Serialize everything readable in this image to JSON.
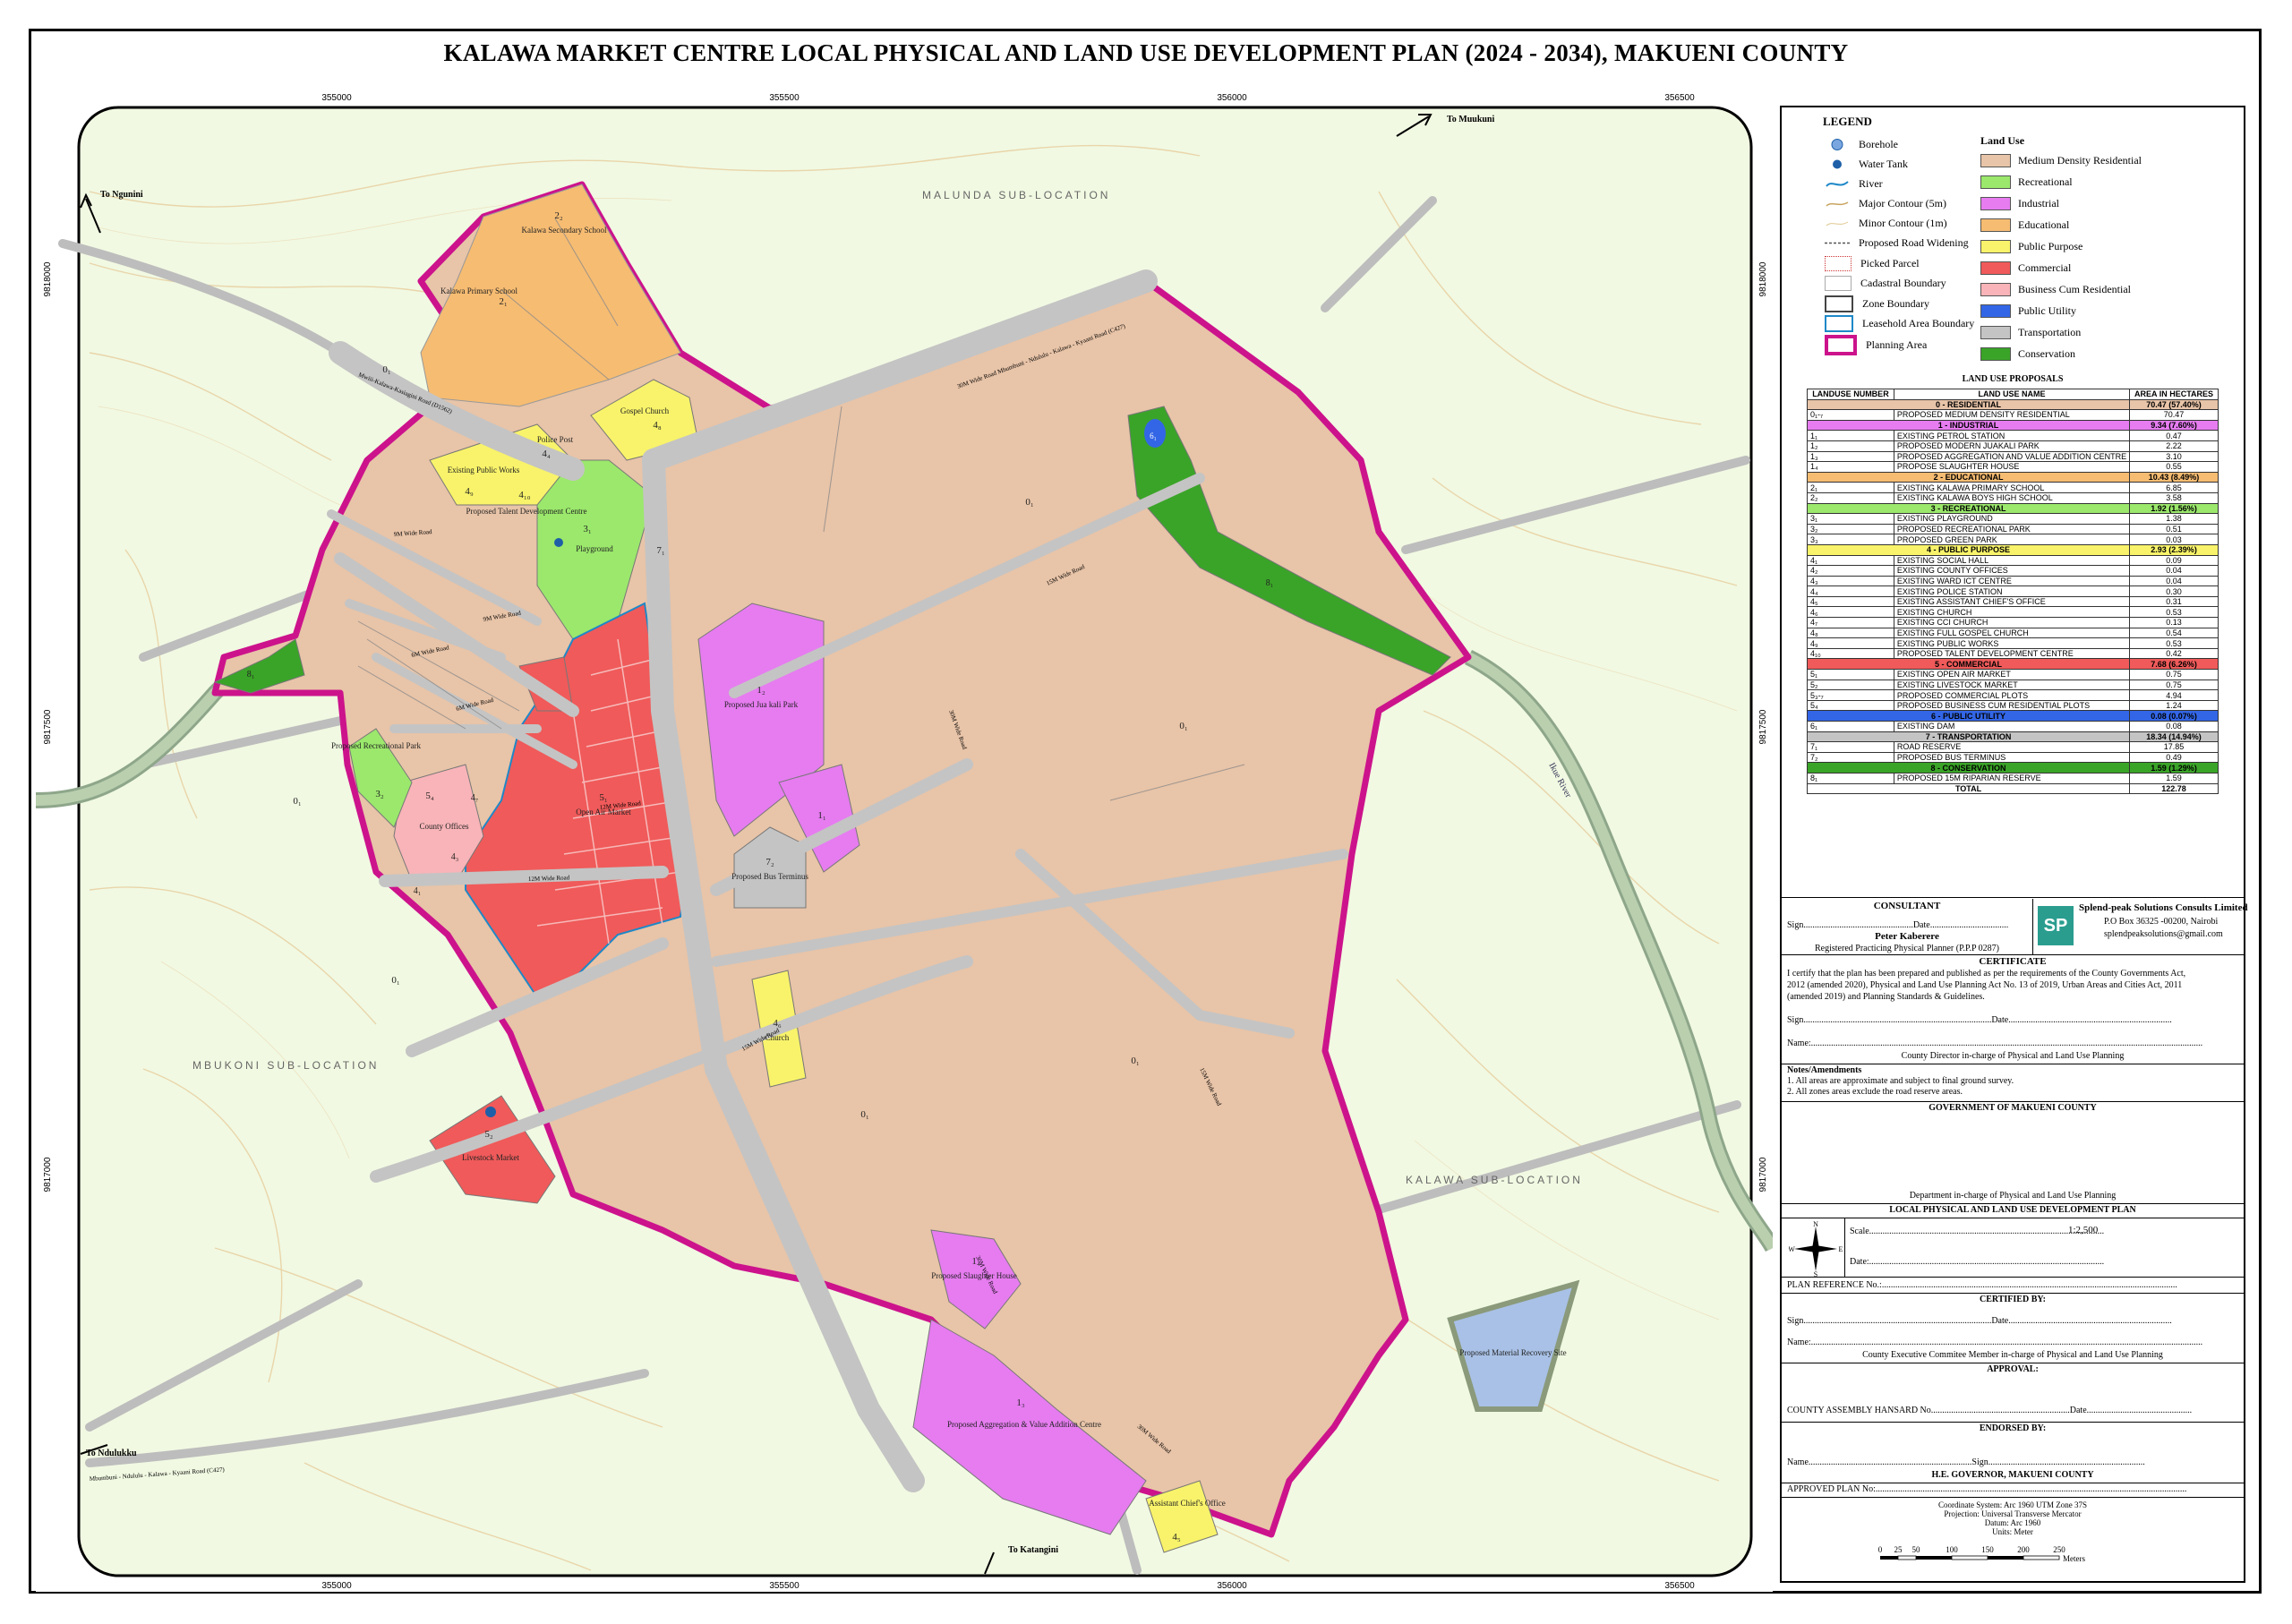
{
  "title": "KALAWA MARKET CENTRE LOCAL PHYSICAL AND LAND USE DEVELOPMENT PLAN (2024 - 2034), MAKUENI COUNTY",
  "grid": {
    "easting": [
      "355000",
      "355500",
      "356000",
      "356500"
    ],
    "northing": [
      "9818000",
      "9817500",
      "9817000"
    ]
  },
  "map": {
    "directions": {
      "to_ngunini": "To Ngunini",
      "to_muukuni": "To Muukuni",
      "to_ndulukku": "To Ndulukku",
      "to_katangini": "To Katangini"
    },
    "sublocations": {
      "malunda": "MALUNDA SUB-LOCATION",
      "mbukoni": "MBUKONI SUB-LOCATION",
      "kalawa": "KALAWA SUB-LOCATION"
    },
    "roads": {
      "mwiii": "Mwiii-Kalawa-Kasiagini Road (D1562)",
      "mbumbuni_top": "30M Wide Road  Mbumbuni - Ndululu - Kalawa - Kyaani Road (C427)",
      "mbumbuni_bottom": "Mbumbuni - Ndululu - Kalawa - Kyaani Road (C427)",
      "r30": "30M Wide Road",
      "r15": "15M Wide Road",
      "r12": "12M Wide Road",
      "r9": "9M Wide Road",
      "r6": "6M Wide Road"
    },
    "river": "Ikue River",
    "labels": {
      "primary": "Kalawa Primary School",
      "primary_code": "2₁",
      "secondary": "Kalawa Secondary School",
      "secondary_code": "2₂",
      "gospel": "Gospel Church",
      "gospel_code": "4₈",
      "police": "Police Post",
      "police_code": "4₄",
      "public_works": "Existing Public Works",
      "public_works_code": "4₉",
      "talent": "Proposed Talent Development Centre",
      "talent_code": "4₁₀",
      "playground": "Playground",
      "playground_code": "3₁",
      "jua_kali": "Proposed Jua kali Park",
      "jua_kali_code": "1₂",
      "open_air": "Open Air Market",
      "open_air_code": "5₁",
      "bus": "Proposed Bus Terminus",
      "bus_code": "7₂",
      "church": "Church",
      "church_code": "4₆",
      "petrol_code": "1₁",
      "rec_park": "Proposed Recreational Park",
      "rec_park_code": "3₂",
      "bcr_code": "5₄",
      "county": "County Offices",
      "livestock": "Livestock Market",
      "livestock_code": "5₂",
      "slaughter": "Proposed Slaughter House",
      "slaughter_code": "1₄",
      "agg": "Proposed Aggregation & Value Addition Centre",
      "agg_code": "1₃",
      "chief": "Assistant Chief's Office",
      "chief_code": "4₅",
      "mrs": "Proposed Material Recovery Site",
      "res_code": "0₁",
      "cons_code": "8₁",
      "dam_code": "6₁",
      "road_code": "7₁",
      "ward_code": "4₃",
      "hall_code": "4₁",
      "ccm_code": "4₇"
    }
  },
  "legend": {
    "title": "LEGEND",
    "symbols": [
      "Borehole",
      "Water Tank",
      "River",
      "Major Contour (5m)",
      "Minor Contour (1m)",
      "Proposed Road Widening",
      "Picked Parcel",
      "Cadastral Boundary",
      "Zone Boundary",
      "Leasehold Area Boundary",
      "Planning Area"
    ],
    "land_use_title": "Land Use",
    "land_uses": [
      {
        "label": "Medium Density Residential",
        "color": "#e8c4a8"
      },
      {
        "label": "Recreational",
        "color": "#9be86c"
      },
      {
        "label": "Industrial",
        "color": "#e67cf0"
      },
      {
        "label": "Educational",
        "color": "#f6bc72"
      },
      {
        "label": "Public Purpose",
        "color": "#f8f36a"
      },
      {
        "label": "Commercial",
        "color": "#f05a5a"
      },
      {
        "label": "Business Cum Residential",
        "color": "#f8b4b8"
      },
      {
        "label": "Public Utility",
        "color": "#3366e6"
      },
      {
        "label": "Transportation",
        "color": "#c4c4c4"
      },
      {
        "label": "Conservation",
        "color": "#3aa428"
      }
    ]
  },
  "table": {
    "title": "LAND USE PROPOSALS",
    "headers": [
      "LANDUSE NUMBER",
      "LAND USE NAME",
      "AREA IN HECTARES"
    ],
    "rows": [
      {
        "cat": true,
        "name": "0 - RESIDENTIAL",
        "area": "70.47 (57.40%)",
        "color": "#e8c4a8"
      },
      {
        "num": "0₁-₇",
        "name": "PROPOSED MEDIUM DENSITY RESIDENTIAL",
        "area": "70.47"
      },
      {
        "cat": true,
        "name": "1 - INDUSTRIAL",
        "area": "9.34 (7.60%)",
        "color": "#e67cf0"
      },
      {
        "num": "1₁",
        "name": "EXISTING PETROL STATION",
        "area": "0.47"
      },
      {
        "num": "1₂",
        "name": "PROPOSED MODERN JUAKALI PARK",
        "area": "2.22"
      },
      {
        "num": "1₃",
        "name": "PROPOSED AGGREGATION AND VALUE ADDITION CENTRE",
        "area": "3.10"
      },
      {
        "num": "1₄",
        "name": "PROPOSE SLAUGHTER HOUSE",
        "area": "0.55"
      },
      {
        "cat": true,
        "name": "2 - EDUCATIONAL",
        "area": "10.43 (8.49%)",
        "color": "#f6bc72"
      },
      {
        "num": "2₁",
        "name": "EXISTING KALAWA PRIMARY SCHOOL",
        "area": "6.85"
      },
      {
        "num": "2₂",
        "name": "EXISTING KALAWA BOYS HIGH SCHOOL",
        "area": "3.58"
      },
      {
        "cat": true,
        "name": "3 - RECREATIONAL",
        "area": "1.92 (1.56%)",
        "color": "#9be86c"
      },
      {
        "num": "3₁",
        "name": "EXISTING PLAYGROUND",
        "area": "1.38"
      },
      {
        "num": "3₂",
        "name": "PROPOSED RECREATIONAL PARK",
        "area": "0.51"
      },
      {
        "num": "3₃",
        "name": "PROPOSED GREEN PARK",
        "area": "0.03"
      },
      {
        "cat": true,
        "name": "4 - PUBLIC PURPOSE",
        "area": "2.93 (2.39%)",
        "color": "#f8f36a"
      },
      {
        "num": "4₁",
        "name": "EXISTING SOCIAL HALL",
        "area": "0.09"
      },
      {
        "num": "4₂",
        "name": "EXISTING COUNTY OFFICES",
        "area": "0.04"
      },
      {
        "num": "4₃",
        "name": "EXISTING WARD ICT CENTRE",
        "area": "0.04"
      },
      {
        "num": "4₄",
        "name": "EXISTING POLICE STATION",
        "area": "0.30"
      },
      {
        "num": "4₅",
        "name": "EXISTING ASSISTANT CHIEF'S OFFICE",
        "area": "0.31"
      },
      {
        "num": "4₆",
        "name": "EXISTING CHURCH",
        "area": "0.53"
      },
      {
        "num": "4₇",
        "name": "EXISTING CCI CHURCH",
        "area": "0.13"
      },
      {
        "num": "4₈",
        "name": "EXISTING FULL GOSPEL CHURCH",
        "area": "0.54"
      },
      {
        "num": "4₉",
        "name": "EXISTING PUBLIC WORKS",
        "area": "0.53"
      },
      {
        "num": "4₁₀",
        "name": "PROPOSED TALENT DEVELOPMENT CENTRE",
        "area": "0.42"
      },
      {
        "cat": true,
        "name": "5 - COMMERCIAL",
        "area": "7.68 (6.26%)",
        "color": "#f05a5a"
      },
      {
        "num": "5₁",
        "name": "EXISTING OPEN AIR MARKET",
        "area": "0.75"
      },
      {
        "num": "5₂",
        "name": "EXISTING LIVESTOCK MARKET",
        "area": "0.75"
      },
      {
        "num": "5₃-₇",
        "name": "PROPOSED COMMERCIAL PLOTS",
        "area": "4.94"
      },
      {
        "num": "5₄",
        "name": "PROPOSED BUSINESS CUM RESIDENTIAL PLOTS",
        "area": "1.24"
      },
      {
        "cat": true,
        "name": "6 - PUBLIC UTILITY",
        "area": "0.08 (0.07%)",
        "color": "#3366e6"
      },
      {
        "num": "6₁",
        "name": "EXISTING DAM",
        "area": "0.08"
      },
      {
        "cat": true,
        "name": "7 - TRANSPORTATION",
        "area": "18.34 (14.94%)",
        "color": "#c4c4c4"
      },
      {
        "num": "7₁",
        "name": "ROAD RESERVE",
        "area": "17.85"
      },
      {
        "num": "7₂",
        "name": "PROPOSED BUS TERMINUS",
        "area": "0.49"
      },
      {
        "cat": true,
        "name": "8 - CONSERVATION",
        "area": "1.59 (1.29%)",
        "color": "#3aa428"
      },
      {
        "num": "8₁",
        "name": "PROPOSED 15M RIPARIAN RESERVE",
        "area": "1.59"
      },
      {
        "total": true,
        "name": "TOTAL",
        "area": "122.78"
      }
    ]
  },
  "consultant": {
    "heading": "CONSULTANT",
    "sign_line": "Sign.................................................Date...................................",
    "name": "Peter Kaberere",
    "role": "Registered Practicing Physical Planner (P.P.P 0287)",
    "logo": "SP",
    "company": "Splend-peak Solutions Consults Limited",
    "address": "P.O Box 36325 -00200, Nairobi",
    "email": "splendpeaksolutions@gmail.com"
  },
  "certificate": {
    "heading": "CERTIFICATE",
    "text1": "I certify that the plan has been prepared and published as per the requirements of the County Governments Act,",
    "text2": "2012 (amended 2020), Physical and Land Use Planning Act  No. 13 of 2019, Urban Areas and Cities Act, 2011",
    "text3": "(amended 2019) and Planning Standards & Guidelines.",
    "sign": "Sign....................................................................................Date.........................................................................",
    "name": "Name:...............................................................................................................................................................................",
    "role": "County Director in-charge of Physical and Land Use Planning"
  },
  "notes": {
    "heading": "Notes/Amendments",
    "n1": "1. All areas are approximate and subject to final ground survey.",
    "n2": "2. All zones areas exclude the road reserve areas."
  },
  "government": {
    "heading": "GOVERNMENT OF MAKUENI COUNTY",
    "dept": "Department in-charge of  Physical and Land Use Planning"
  },
  "plan": {
    "heading": "LOCAL PHYSICAL AND LAND USE DEVELOPMENT PLAN",
    "scale_label": "Scale.........................................................................................................",
    "scale_value": "1:2,500",
    "date_label": "Date:.........................................................................................................",
    "compass": {
      "n": "N",
      "s": "S",
      "e": "E",
      "w": "W"
    },
    "ref": "PLAN REFERENCE No.:...................................................................................................................................."
  },
  "certified": {
    "heading": "CERTIFIED BY:",
    "sign": "Sign....................................................................................Date.........................................................................",
    "name": "Name:...............................................................................................................................................................................",
    "role": "County Executive Commitee Member  in-charge of  Physical and Land Use Planning"
  },
  "approval": {
    "heading": "APPROVAL:",
    "hansard": "COUNTY ASSEMBLY HANSARD No..............................................................Date..............................................."
  },
  "endorsed": {
    "heading": "ENDORSED BY:",
    "line": "Name.........................................................................Sign......................................................................",
    "role": "H.E. GOVERNOR, MAKUENI COUNTY"
  },
  "approved_plan": "APPROVED PLAN No:...........................................................................................................................................",
  "coords": {
    "c1": "Coordinate System: Arc 1960 UTM Zone 37S",
    "c2": "Projection: Universal Transverse Mercator",
    "c3": "Datum: Arc 1960",
    "c4": "Units: Meter"
  },
  "scalebar": {
    "ticks": [
      "0",
      "25",
      "50",
      "100",
      "150",
      "200",
      "250"
    ],
    "unit": "Meters"
  }
}
